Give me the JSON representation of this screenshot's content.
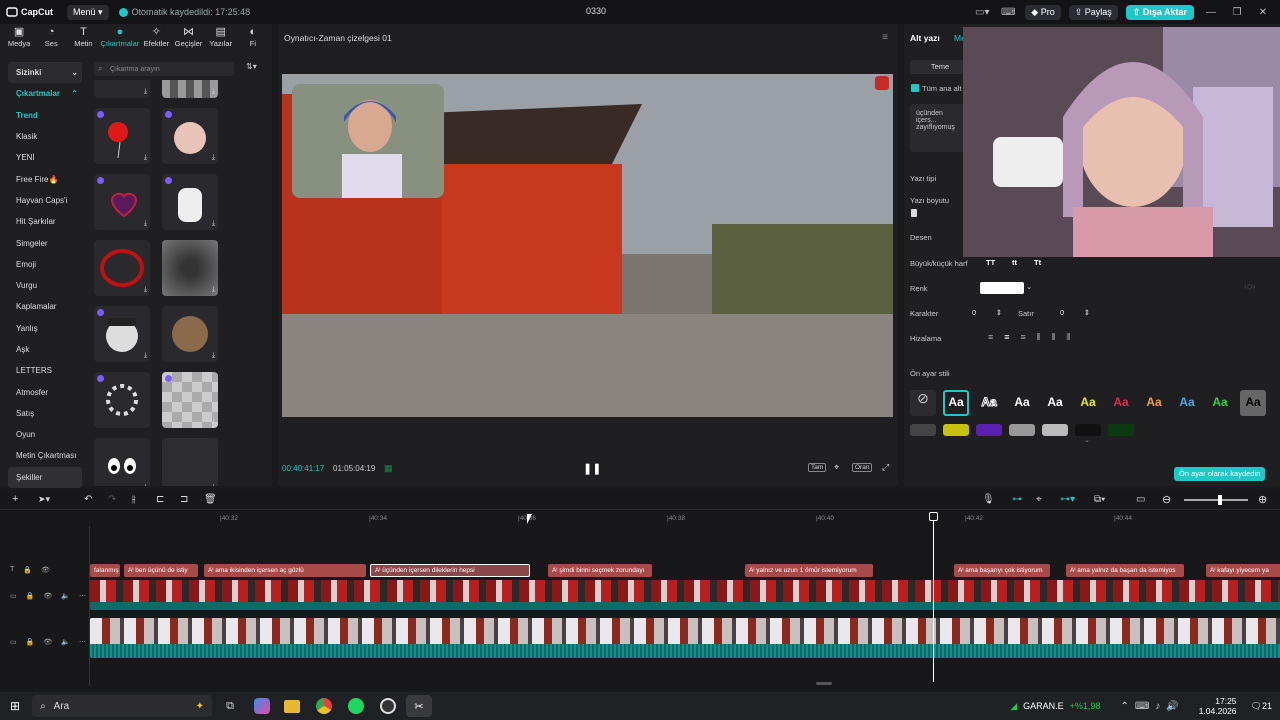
{
  "app": {
    "logo": "CapCut",
    "menu_label": "Menü",
    "autosave": "Otomatik kaydedildi: 17:25:48",
    "project_name": "0330"
  },
  "topbar": {
    "pro": "Pro",
    "share": "Paylaş",
    "export": "Dışa Aktar"
  },
  "tabs": [
    {
      "label": "Medya",
      "icon": "media-icon"
    },
    {
      "label": "Ses",
      "icon": "audio-icon"
    },
    {
      "label": "Metin",
      "icon": "text-icon"
    },
    {
      "label": "Çıkartmalar",
      "icon": "stickers-icon"
    },
    {
      "label": "Efektler",
      "icon": "effects-icon"
    },
    {
      "label": "Geçişler",
      "icon": "transitions-icon"
    },
    {
      "label": "Yazılar",
      "icon": "captions-icon"
    },
    {
      "label": "Fi",
      "icon": "filters-icon"
    }
  ],
  "sidebar": {
    "header1": "Sizinki",
    "header2": "Çıkartmalar",
    "items": [
      "Trend",
      "Klasik",
      "YENİ",
      "Free Fire🔥",
      "Hayvan Caps'i",
      "Hit Şarkılar",
      "Simgeler",
      "Emoji",
      "Vurgu",
      "Kaplamalar",
      "Yanlış",
      "Aşk",
      "LETTERS",
      "Atmosfer",
      "Satış",
      "Oyun",
      "Metin Çıkartması",
      "Şekiller"
    ],
    "selected": "Trend",
    "highlighted": "Şekiller"
  },
  "search": {
    "placeholder": "Çıkartma arayın"
  },
  "player": {
    "title": "Oynatıcı-Zaman çizelgesi 01",
    "time_current": "00:40:41:17",
    "time_total": "01:05:04:19",
    "full_label": "Tam",
    "ratio_label": "Oran"
  },
  "right_panel": {
    "title": "Alt yazı",
    "tab2": "Me",
    "temel_tab": "Teme",
    "checkbox_label": "Tüm ana alt",
    "text_preview": "üçünden içers... zayıflıyomuş",
    "font_label": "Yazı tipi",
    "size_label": "Yazı boyutu",
    "pattern_label": "Desen",
    "case_label": "Büyük/küçük harf",
    "case_options": [
      "TT",
      "tt",
      "Tt"
    ],
    "color_label": "Renk",
    "color_value": "#ffffff",
    "char_label": "Karakter",
    "char_value": "0",
    "line_label": "Satır",
    "line_value": "0",
    "align_label": "Hizalama",
    "preset_label": "Ön ayar stili",
    "preset_glyph": "Aa",
    "save_preset": "Ön ayar olarak kaydedin"
  },
  "timeline": {
    "ruler": [
      "|40:32",
      "|40:34",
      "|40:36",
      "|40:38",
      "|40:40",
      "|40:42",
      "|40:44"
    ],
    "captions": [
      {
        "text": "falanmış",
        "sel": false
      },
      {
        "text": "Aᴵ ben üçünü de istiy",
        "sel": false
      },
      {
        "text": "Aᴵ ama ikisinden içersen aç gözlü",
        "sel": false
      },
      {
        "text": "Aᴵ üçünden içersen dileklerin hepsi",
        "sel": true
      },
      {
        "text": "Aᴵ şimdi birini seçmek zorundayı",
        "sel": false
      },
      {
        "text": "Aᴵ yalnız ve uzun 1 ömür istemiyorum",
        "sel": false
      },
      {
        "text": "Aᴵ ama başarıyı çok istiyorum",
        "sel": false
      },
      {
        "text": "Aᴵ ama yalnız da başarı da istemiyos",
        "sel": false
      },
      {
        "text": "Aᴵ kafayı yiyecem ya",
        "sel": false
      }
    ]
  },
  "taskbar": {
    "search": "Ara",
    "stock": "GARAN.E",
    "stock_change": "+%1,98",
    "time": "17:25",
    "date": "1.04.2026",
    "notif": "21"
  },
  "colors": {
    "accent": "#1ec8c8",
    "caption_clip": "#a84a4a"
  }
}
